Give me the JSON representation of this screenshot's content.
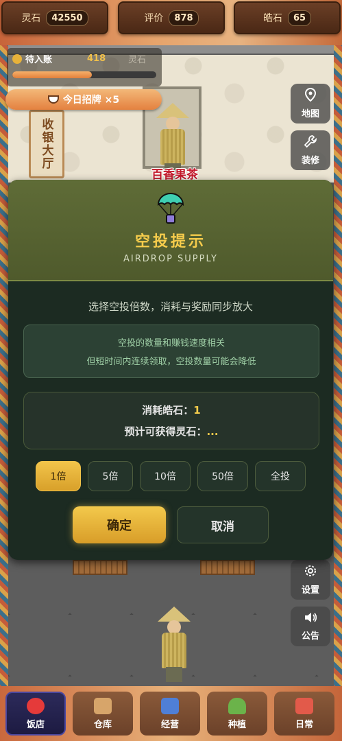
{
  "stats": {
    "spirit_stone": {
      "label": "灵石",
      "value": "42550"
    },
    "rating": {
      "label": "评价",
      "value": "878"
    },
    "haoshi": {
      "label": "皓石",
      "value": "65"
    }
  },
  "pending": {
    "label": "待入账",
    "amount": "418",
    "unit": "灵石",
    "progress": 0.55
  },
  "signboard": {
    "label": "今日招牌 ×5"
  },
  "scene": {
    "hall_sign": "收银大厅",
    "shop_name": "百香果茶"
  },
  "side_buttons": {
    "map": "地图",
    "decorate": "装修",
    "settings": "设置",
    "notice": "公告"
  },
  "modal": {
    "title": "空投提示",
    "subtitle": "AIRDROP SUPPLY",
    "description": "选择空投倍数，消耗与奖励同步放大",
    "info_line1": "空投的数量和赚钱速度相关",
    "info_line2": "但短时间内连续领取，空投数量可能会降低",
    "cost_label": "消耗皓石：",
    "cost_value": "1",
    "reward_label": "预计可获得灵石：",
    "reward_value": "...",
    "multipliers": [
      "1倍",
      "5倍",
      "10倍",
      "50倍",
      "全投"
    ],
    "selected_multiplier": "1倍",
    "confirm": "确定",
    "cancel": "取消"
  },
  "nav": {
    "items": [
      {
        "label": "饭店",
        "icon": "restaurant-icon",
        "color": "#e53a3a"
      },
      {
        "label": "仓库",
        "icon": "warehouse-icon",
        "color": "#d7a56a"
      },
      {
        "label": "经营",
        "icon": "business-icon",
        "color": "#4f7fd6"
      },
      {
        "label": "种植",
        "icon": "planting-icon",
        "color": "#6bb34a"
      },
      {
        "label": "日常",
        "icon": "daily-icon",
        "color": "#e25a4a"
      }
    ]
  },
  "colors": {
    "accent": "#f5cc4c",
    "modal_bg": "#1c2b22",
    "modal_head": "#5f6c37"
  }
}
